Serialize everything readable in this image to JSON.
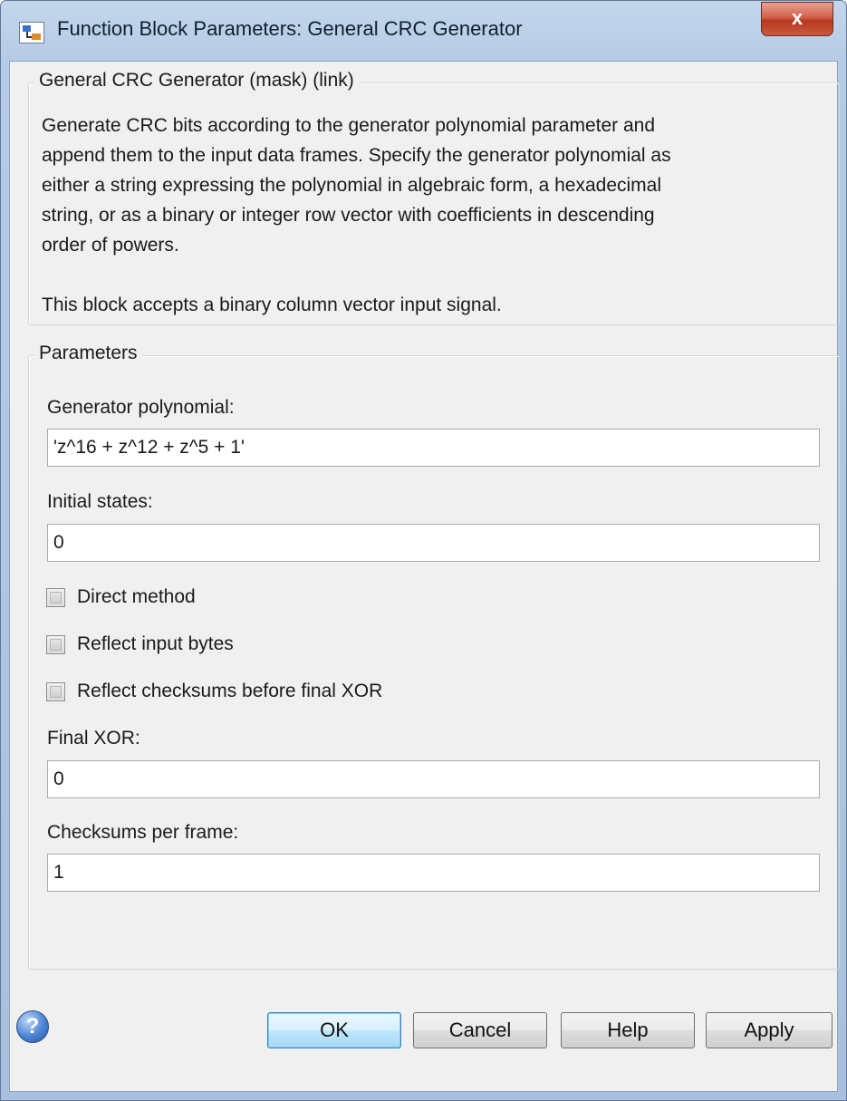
{
  "window": {
    "title": "Function Block Parameters: General CRC Generator",
    "close_symbol": "x"
  },
  "description_group": {
    "title": "General CRC Generator (mask) (link)",
    "text": "Generate CRC bits according to the generator polynomial parameter and\nappend them to the input data frames. Specify the generator polynomial as\neither a string expressing the polynomial in algebraic form, a hexadecimal\nstring, or as a binary or integer row vector with coefficients in descending\norder of powers.\n\nThis block accepts a binary column vector input signal."
  },
  "parameters_group": {
    "title": "Parameters",
    "generator_polynomial": {
      "label": "Generator polynomial:",
      "value": "'z^16 + z^12 + z^5 + 1'"
    },
    "initial_states": {
      "label": "Initial states:",
      "value": "0"
    },
    "direct_method": {
      "label": "Direct method",
      "checked": false
    },
    "reflect_input_bytes": {
      "label": "Reflect input bytes",
      "checked": false
    },
    "reflect_checksums": {
      "label": "Reflect checksums before final XOR",
      "checked": false
    },
    "final_xor": {
      "label": "Final XOR:",
      "value": "0"
    },
    "checksums_per_frame": {
      "label": "Checksums per frame:",
      "value": "1"
    }
  },
  "buttons": {
    "help_symbol": "?",
    "ok": "OK",
    "cancel": "Cancel",
    "help": "Help",
    "apply": "Apply"
  },
  "icons": [
    "simulink-block-icon",
    "close-icon",
    "help-circle-icon"
  ]
}
